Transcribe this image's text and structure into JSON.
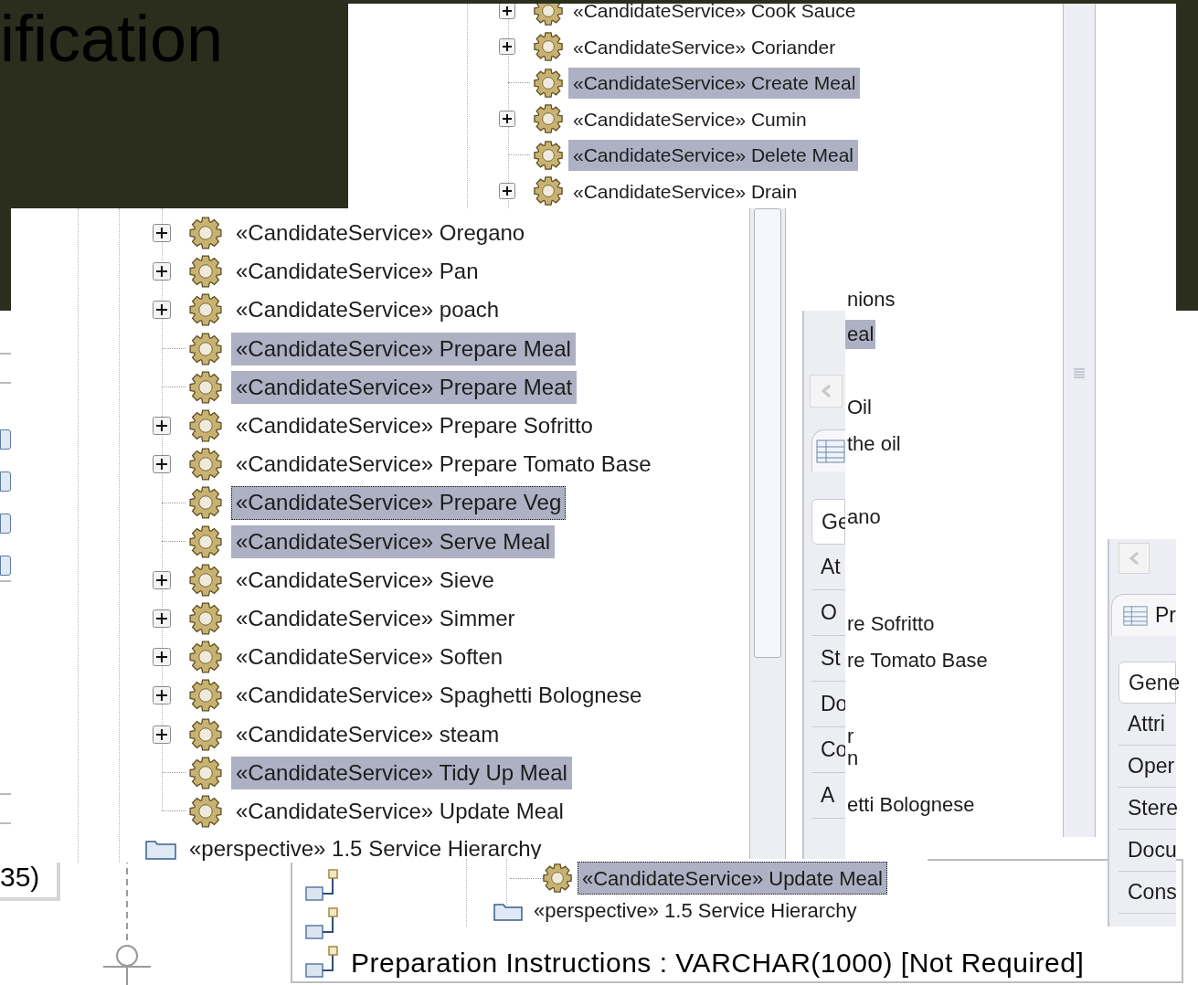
{
  "slide_title": "ification",
  "upper_tree": {
    "rows": [
      {
        "label": "«CandidateService» Cook Sauce",
        "expandable": true,
        "selected": false
      },
      {
        "label": "«CandidateService» Coriander",
        "expandable": true,
        "selected": false
      },
      {
        "label": "«CandidateService» Create Meal",
        "expandable": false,
        "selected": true
      },
      {
        "label": "«CandidateService» Cumin",
        "expandable": true,
        "selected": false
      },
      {
        "label": "«CandidateService» Delete Meal",
        "expandable": false,
        "selected": true
      },
      {
        "label": "«CandidateService» Drain",
        "expandable": true,
        "selected": false
      }
    ]
  },
  "fragment_list": {
    "rows": [
      {
        "text": "nions",
        "selected": false
      },
      {
        "text": "eal",
        "selected": true
      },
      {
        "text": "Oil",
        "selected": false
      },
      {
        "text": "the oil",
        "selected": false
      },
      {
        "text": "ano",
        "selected": false
      },
      {
        "text": "re Sofritto",
        "selected": false
      },
      {
        "text": "re Tomato Base",
        "selected": false
      },
      {
        "text": "r",
        "selected": false
      },
      {
        "text": "n",
        "selected": false
      },
      {
        "text": "etti Bolognese",
        "selected": false
      }
    ]
  },
  "middle_panel": {
    "tabs": [
      {
        "label": "Ge",
        "selected": true
      },
      {
        "label": "At",
        "selected": false
      },
      {
        "label": "O",
        "selected": false
      },
      {
        "label": "St",
        "selected": false
      },
      {
        "label": "Do",
        "selected": false
      },
      {
        "label": "Co",
        "selected": false
      },
      {
        "label": "A",
        "selected": false
      }
    ]
  },
  "right_panel": {
    "title": "Pr",
    "tabs": [
      {
        "label": "Gene",
        "selected": true
      },
      {
        "label": "Attri",
        "selected": false
      },
      {
        "label": "Oper",
        "selected": false
      },
      {
        "label": "Stere",
        "selected": false
      },
      {
        "label": "Docu",
        "selected": false
      },
      {
        "label": "Cons",
        "selected": false
      }
    ]
  },
  "left_fragment": {
    "label": "35)"
  },
  "main_tree": {
    "rows": [
      {
        "label": "«CandidateService» Oregano",
        "expandable": true,
        "selected": false,
        "focused": false
      },
      {
        "label": "«CandidateService» Pan",
        "expandable": true,
        "selected": false,
        "focused": false
      },
      {
        "label": "«CandidateService» poach",
        "expandable": true,
        "selected": false,
        "focused": false
      },
      {
        "label": "«CandidateService» Prepare Meal",
        "expandable": false,
        "selected": true,
        "focused": false
      },
      {
        "label": "«CandidateService» Prepare Meat",
        "expandable": false,
        "selected": true,
        "focused": false
      },
      {
        "label": "«CandidateService» Prepare Sofritto",
        "expandable": true,
        "selected": false,
        "focused": false
      },
      {
        "label": "«CandidateService» Prepare Tomato Base",
        "expandable": true,
        "selected": false,
        "focused": false
      },
      {
        "label": "«CandidateService» Prepare Veg",
        "expandable": false,
        "selected": true,
        "focused": true
      },
      {
        "label": "«CandidateService» Serve Meal",
        "expandable": false,
        "selected": true,
        "focused": false
      },
      {
        "label": "«CandidateService» Sieve",
        "expandable": true,
        "selected": false,
        "focused": false
      },
      {
        "label": "«CandidateService» Simmer",
        "expandable": true,
        "selected": false,
        "focused": false
      },
      {
        "label": "«CandidateService» Soften",
        "expandable": true,
        "selected": false,
        "focused": false
      },
      {
        "label": "«CandidateService» Spaghetti Bolognese",
        "expandable": true,
        "selected": false,
        "focused": false
      },
      {
        "label": "«CandidateService» steam",
        "expandable": true,
        "selected": false,
        "focused": false
      },
      {
        "label": "«CandidateService» Tidy Up Meal",
        "expandable": false,
        "selected": true,
        "focused": false
      },
      {
        "label": "«CandidateService» Update Meal",
        "expandable": false,
        "selected": false,
        "focused": false
      }
    ],
    "folder": "«perspective» 1.5 Service Hierarchy"
  },
  "entity_box": {
    "attributes": [
      {
        "kind": "hidden"
      },
      {
        "kind": "hidden"
      },
      {
        "kind": "text",
        "text": "Preparation Instructions : VARCHAR(1000) [Not Required]"
      }
    ]
  },
  "lower_tree": {
    "row": {
      "label": "«CandidateService» Update Meal",
      "selected": true,
      "focused": true
    },
    "folder": "«perspective» 1.5 Service Hierarchy"
  }
}
